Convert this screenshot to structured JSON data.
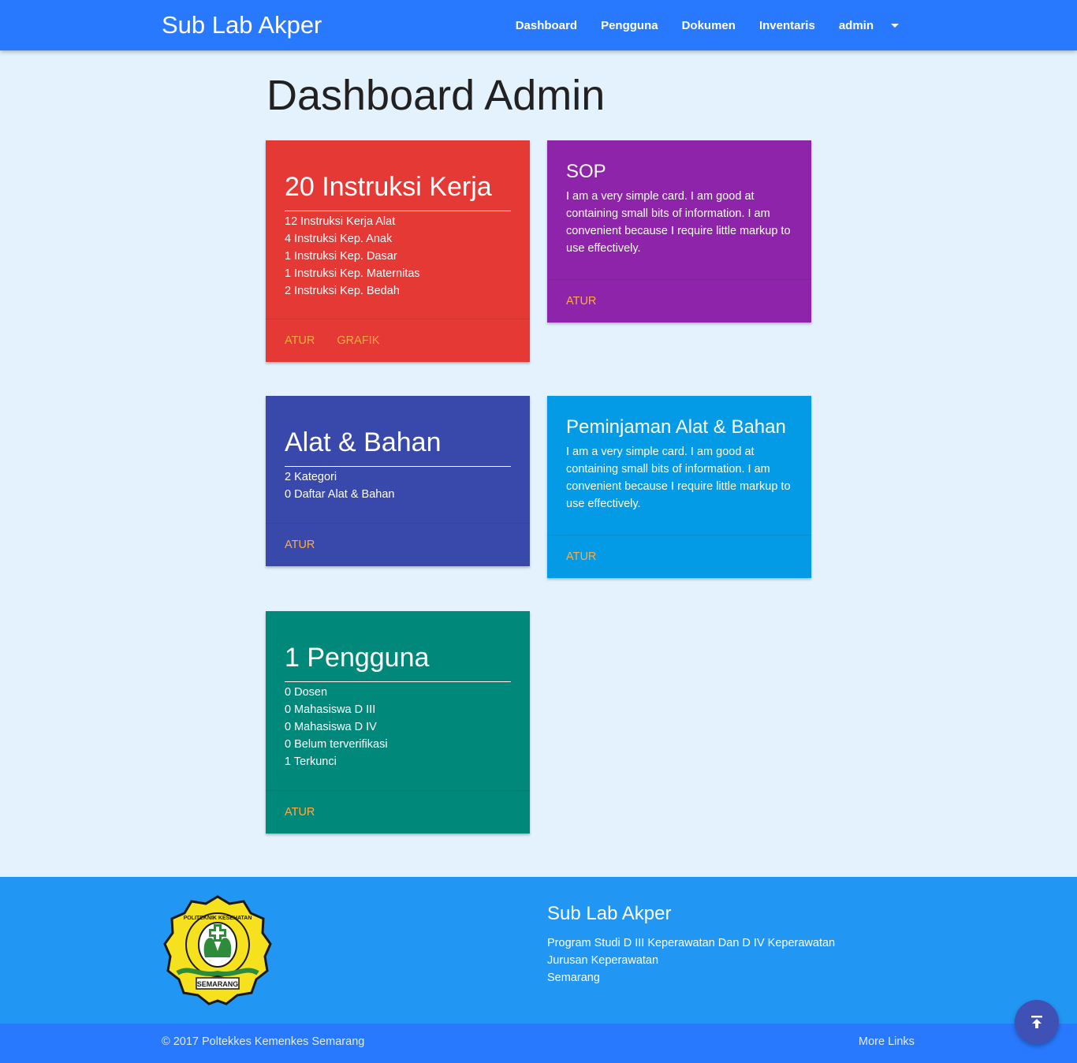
{
  "navbar": {
    "brand": "Sub Lab Akper",
    "links": [
      "Dashboard",
      "Pengguna",
      "Dokumen",
      "Inventaris"
    ],
    "user": "admin"
  },
  "page": {
    "title": "Dashboard Admin"
  },
  "cards": {
    "instruksi": {
      "title": "20 Instruksi Kerja",
      "items": [
        "12 Instruksi Kerja Alat",
        "4 Instruksi Kep. Anak",
        "1 Instruksi Kep. Dasar",
        "1 Instruksi Kep. Maternitas",
        "2 Instruksi Kep. Bedah"
      ],
      "actions": [
        "ATUR",
        "GRAFIK"
      ]
    },
    "sop": {
      "title": "SOP",
      "text": "I am a very simple card. I am good at containing small bits of information. I am convenient because I require little markup to use effectively.",
      "actions": [
        "ATUR"
      ]
    },
    "alat": {
      "title": "Alat & Bahan",
      "items": [
        "2 Kategori",
        "0 Daftar Alat & Bahan"
      ],
      "actions": [
        "ATUR"
      ]
    },
    "peminjaman": {
      "title": "Peminjaman Alat & Bahan",
      "text": "I am a very simple card. I am good at containing small bits of information. I am convenient because I require little markup to use effectively.",
      "actions": [
        "ATUR"
      ]
    },
    "pengguna": {
      "title": "1 Pengguna",
      "items": [
        "0 Dosen",
        "0 Mahasiswa D III",
        "0 Mahasiswa D IV",
        "0 Belum terverifikasi",
        "1 Terkunci"
      ],
      "actions": [
        "ATUR"
      ]
    }
  },
  "footer": {
    "logo_text_top": "POLITEKNIK KESEHATAN",
    "logo_text_bottom": "SEMARANG",
    "title": "Sub Lab Akper",
    "lines": [
      "Program Studi D III Keperawatan Dan D IV Keperawatan",
      "Jurusan Keperawatan",
      "Semarang"
    ],
    "copyright": "© 2017 Poltekkes Kemenkes Semarang",
    "more_links": "More Links"
  },
  "fab": {
    "icon": "arrow-up-to-top-icon"
  },
  "colors": {
    "navbar": "#2979ff",
    "background": "#e3f2fd",
    "red": "#e53935",
    "purple": "#8e24aa",
    "indigo": "#3949ab",
    "blue": "#039be5",
    "teal": "#00897b",
    "footer": "#2196f3",
    "action": "#ffab40",
    "fab": "#3f51b5"
  }
}
